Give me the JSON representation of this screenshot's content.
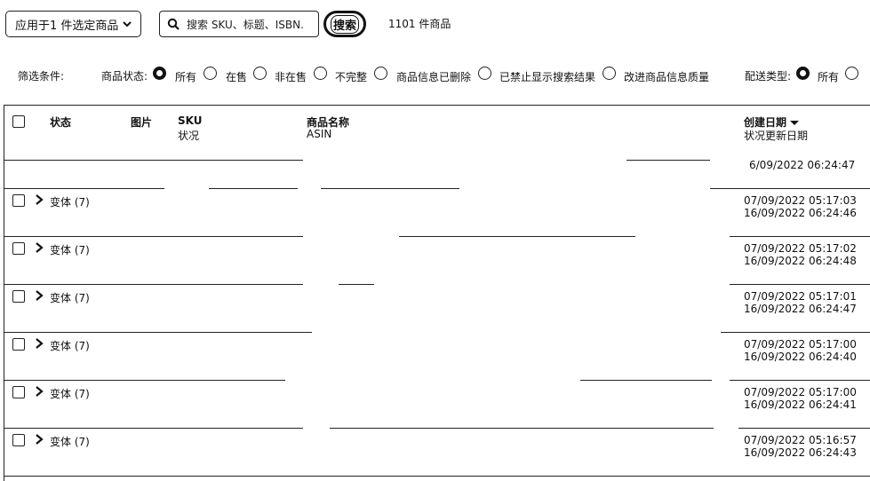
{
  "toolbar": {
    "apply_dropdown_label": "应用于1 件选定商品",
    "search_placeholder": "搜索 SKU、标题、ISBN.",
    "search_button_label": "搜索",
    "result_count": "1101 件商品"
  },
  "filters": {
    "label": "筛选条件:",
    "status_label": "商品状态:",
    "status_options": [
      "所有",
      "在售",
      "非在售",
      "不完整",
      "商品信息已删除",
      "已禁止显示搜索结果",
      "改进商品信息质量"
    ],
    "status_selected": "所有",
    "shipping_label": "配送类型:",
    "shipping_options": [
      "所有"
    ],
    "shipping_selected": "所有"
  },
  "table": {
    "headers": {
      "status": "状态",
      "image": "图片",
      "sku": "SKU",
      "sku_sub": "状况",
      "product_name": "商品名称",
      "product_name_sub": "ASIN",
      "created_date": "创建日期",
      "updated_date": "状况更新日期"
    },
    "partial_row": {
      "updated": "6/09/2022 06:24:47"
    },
    "rows": [
      {
        "label": "变体 (7)",
        "created": "07/09/2022 05:17:03",
        "updated": "16/09/2022 06:24:46"
      },
      {
        "label": "变体 (7)",
        "created": "07/09/2022 05:17:02",
        "updated": "16/09/2022 06:24:48"
      },
      {
        "label": "变体 (7)",
        "created": "07/09/2022 05:17:01",
        "updated": "16/09/2022 06:24:47"
      },
      {
        "label": "变体 (7)",
        "created": "07/09/2022 05:17:00",
        "updated": "16/09/2022 06:24:40"
      },
      {
        "label": "变体 (7)",
        "created": "07/09/2022 05:17:00",
        "updated": "16/09/2022 06:24:41"
      },
      {
        "label": "变体 (7)",
        "created": "07/09/2022 05:16:57",
        "updated": "16/09/2022 06:24:43"
      }
    ]
  },
  "icons": {
    "dropdown": "chevron-down-icon",
    "search": "search-icon",
    "expand": "chevron-right-icon",
    "sort": "sort-desc-icon"
  }
}
